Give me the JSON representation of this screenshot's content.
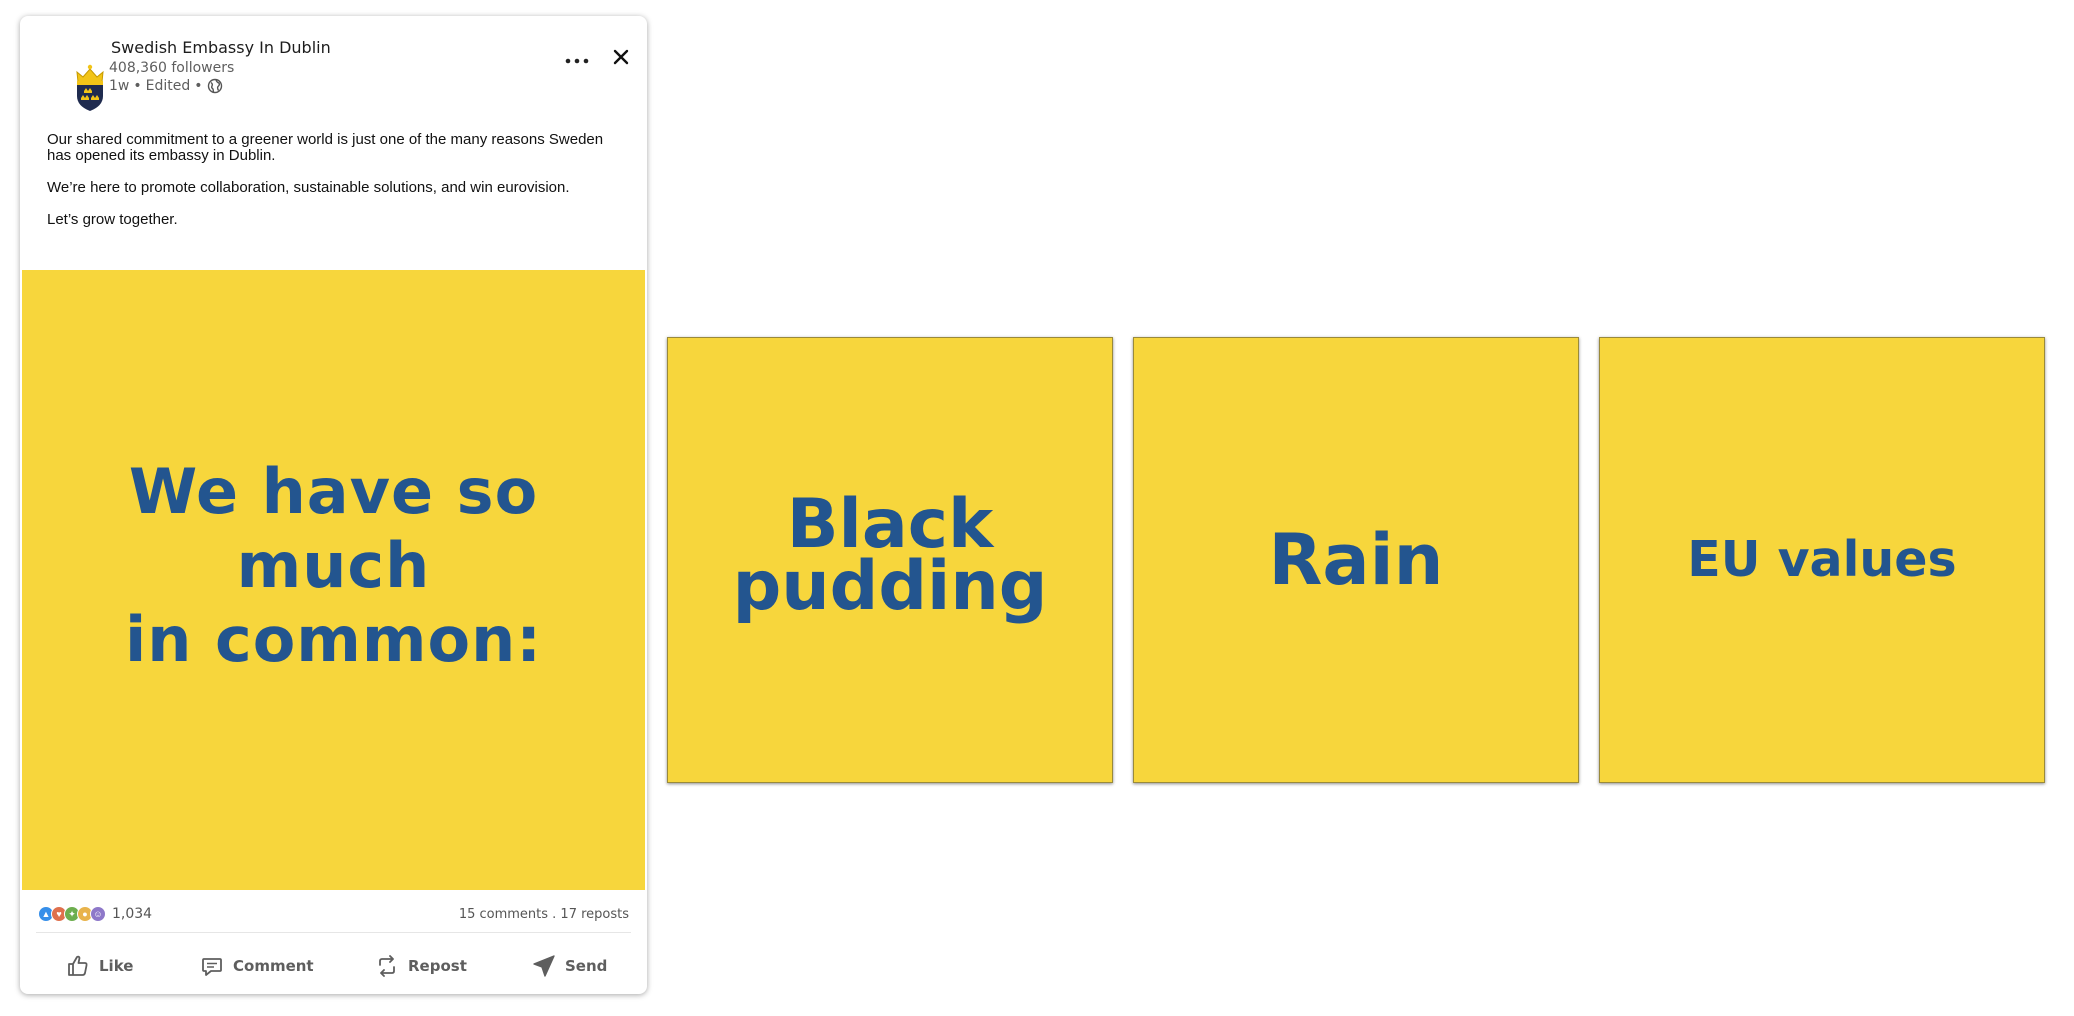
{
  "post": {
    "author": "Swedish Embassy In Dublin",
    "followers": "408,360 followers",
    "time": "1w",
    "edited": "Edited",
    "separator": "•",
    "paragraphs": [
      "Our shared commitment to a greener world is just one of the many reasons Sweden has opened its embassy in Dublin.",
      "We’re here to promote collaboration, sustainable solutions, and win eurovision.",
      "Let’s grow together."
    ],
    "image_headline": "We have so much\nin common:",
    "reaction_count": "1,034",
    "comments_reposts": "15 comments . 17 reposts",
    "actions": {
      "like": "Like",
      "comment": "Comment",
      "repost": "Repost",
      "send": "Send"
    }
  },
  "tiles": [
    "Black\npudding",
    "Rain",
    "EU values"
  ],
  "colors": {
    "tile_yellow": "#f7d63c",
    "tile_text_blue": "#23558f",
    "action_gray": "#5e5e5e"
  },
  "icons": {
    "avatar": "swedish-crown-shield-icon",
    "more": "ellipsis-icon",
    "close": "close-icon",
    "visibility": "globe-icon",
    "like": "thumbs-up-icon",
    "comment": "comment-bubble-icon",
    "repost": "repost-arrows-icon",
    "send": "paper-plane-icon"
  }
}
